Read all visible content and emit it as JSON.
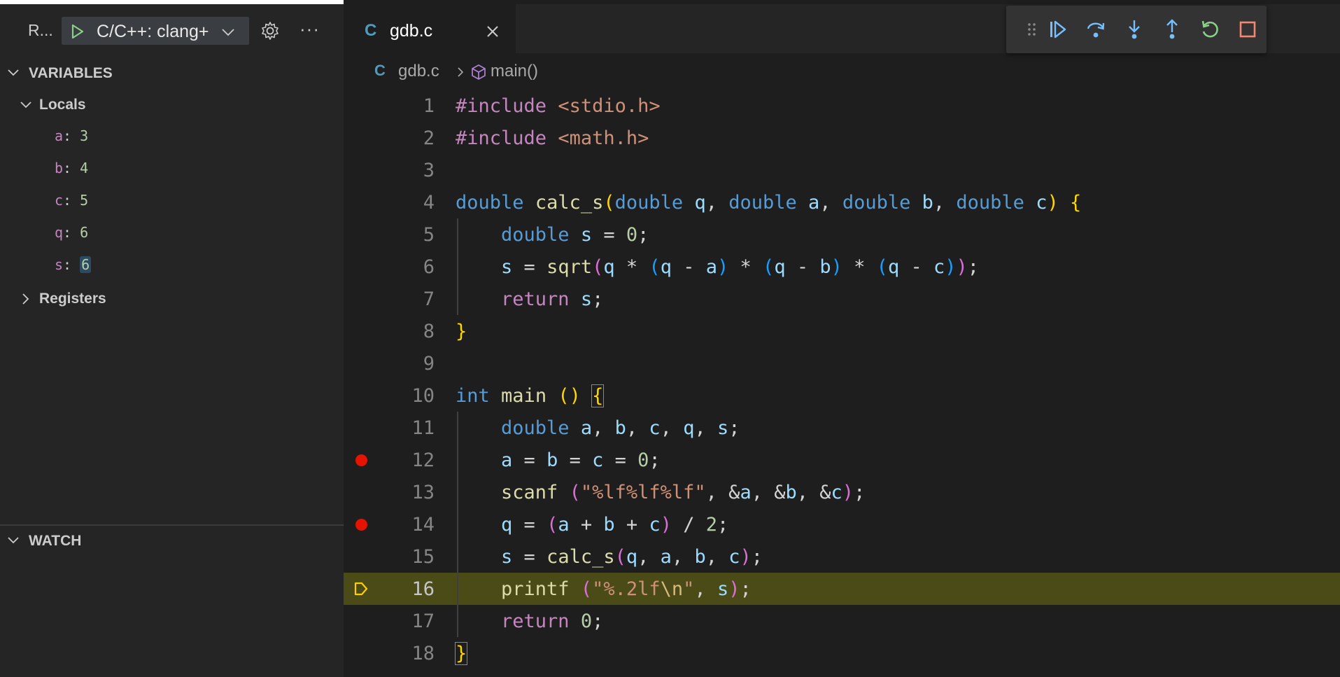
{
  "debug_toolbar": {
    "run_label": "R...",
    "config_label": "C/C++: clang+",
    "more_label": "···"
  },
  "variables": {
    "header": "VARIABLES",
    "locals_label": "Locals",
    "locals": [
      {
        "name": "a",
        "value": "3"
      },
      {
        "name": "b",
        "value": "4"
      },
      {
        "name": "c",
        "value": "5"
      },
      {
        "name": "q",
        "value": "6"
      },
      {
        "name": "s",
        "value": "6"
      }
    ],
    "registers_label": "Registers"
  },
  "watch": {
    "header": "WATCH"
  },
  "editor": {
    "tab": {
      "icon_letter": "C",
      "label": "gdb.c"
    },
    "breadcrumb": {
      "icon_letter": "C",
      "file": "gdb.c",
      "symbol": "main()"
    },
    "current_line": 16,
    "breakpoint_lines": [
      12,
      14
    ],
    "lines": [
      {
        "n": "1",
        "tokens": [
          [
            "pp",
            "#include "
          ],
          [
            "inc",
            "<stdio.h>"
          ]
        ]
      },
      {
        "n": "2",
        "tokens": [
          [
            "pp",
            "#include "
          ],
          [
            "inc",
            "<math.h>"
          ]
        ]
      },
      {
        "n": "3",
        "tokens": []
      },
      {
        "n": "4",
        "tokens": [
          [
            "kw",
            "double"
          ],
          [
            "pl",
            " "
          ],
          [
            "fn",
            "calc_s"
          ],
          [
            "b1",
            "("
          ],
          [
            "kw",
            "double"
          ],
          [
            "pl",
            " "
          ],
          [
            "var",
            "q"
          ],
          [
            "pl",
            ", "
          ],
          [
            "kw",
            "double"
          ],
          [
            "pl",
            " "
          ],
          [
            "var",
            "a"
          ],
          [
            "pl",
            ", "
          ],
          [
            "kw",
            "double"
          ],
          [
            "pl",
            " "
          ],
          [
            "var",
            "b"
          ],
          [
            "pl",
            ", "
          ],
          [
            "kw",
            "double"
          ],
          [
            "pl",
            " "
          ],
          [
            "var",
            "c"
          ],
          [
            "b1",
            ")"
          ],
          [
            "pl",
            " "
          ],
          [
            "b1",
            "{"
          ]
        ]
      },
      {
        "n": "5",
        "tokens": [
          [
            "pl",
            "    "
          ],
          [
            "kw",
            "double"
          ],
          [
            "pl",
            " "
          ],
          [
            "var",
            "s"
          ],
          [
            "pl",
            " = "
          ],
          [
            "num",
            "0"
          ],
          [
            "pl",
            ";"
          ]
        ]
      },
      {
        "n": "6",
        "tokens": [
          [
            "pl",
            "    "
          ],
          [
            "var",
            "s"
          ],
          [
            "pl",
            " = "
          ],
          [
            "fn",
            "sqrt"
          ],
          [
            "b2",
            "("
          ],
          [
            "var",
            "q"
          ],
          [
            "pl",
            " * "
          ],
          [
            "b3",
            "("
          ],
          [
            "var",
            "q"
          ],
          [
            "pl",
            " - "
          ],
          [
            "var",
            "a"
          ],
          [
            "b3",
            ")"
          ],
          [
            "pl",
            " * "
          ],
          [
            "b3",
            "("
          ],
          [
            "var",
            "q"
          ],
          [
            "pl",
            " - "
          ],
          [
            "var",
            "b"
          ],
          [
            "b3",
            ")"
          ],
          [
            "pl",
            " * "
          ],
          [
            "b3",
            "("
          ],
          [
            "var",
            "q"
          ],
          [
            "pl",
            " - "
          ],
          [
            "var",
            "c"
          ],
          [
            "b3",
            ")"
          ],
          [
            "b2",
            ")"
          ],
          [
            "pl",
            ";"
          ]
        ]
      },
      {
        "n": "7",
        "tokens": [
          [
            "pl",
            "    "
          ],
          [
            "ctrl",
            "return"
          ],
          [
            "pl",
            " "
          ],
          [
            "var",
            "s"
          ],
          [
            "pl",
            ";"
          ]
        ]
      },
      {
        "n": "8",
        "tokens": [
          [
            "b1",
            "}"
          ]
        ]
      },
      {
        "n": "9",
        "tokens": []
      },
      {
        "n": "10",
        "tokens": [
          [
            "kw",
            "int"
          ],
          [
            "pl",
            " "
          ],
          [
            "fn",
            "main"
          ],
          [
            "pl",
            " "
          ],
          [
            "b1",
            "()"
          ],
          [
            "pl",
            " "
          ],
          [
            "b1m",
            "{"
          ]
        ]
      },
      {
        "n": "11",
        "tokens": [
          [
            "pl",
            "    "
          ],
          [
            "kw",
            "double"
          ],
          [
            "pl",
            " "
          ],
          [
            "var",
            "a"
          ],
          [
            "pl",
            ", "
          ],
          [
            "var",
            "b"
          ],
          [
            "pl",
            ", "
          ],
          [
            "var",
            "c"
          ],
          [
            "pl",
            ", "
          ],
          [
            "var",
            "q"
          ],
          [
            "pl",
            ", "
          ],
          [
            "var",
            "s"
          ],
          [
            "pl",
            ";"
          ]
        ]
      },
      {
        "n": "12",
        "tokens": [
          [
            "pl",
            "    "
          ],
          [
            "var",
            "a"
          ],
          [
            "pl",
            " = "
          ],
          [
            "var",
            "b"
          ],
          [
            "pl",
            " = "
          ],
          [
            "var",
            "c"
          ],
          [
            "pl",
            " = "
          ],
          [
            "num",
            "0"
          ],
          [
            "pl",
            ";"
          ]
        ]
      },
      {
        "n": "13",
        "tokens": [
          [
            "pl",
            "    "
          ],
          [
            "fn",
            "scanf"
          ],
          [
            "pl",
            " "
          ],
          [
            "b2",
            "("
          ],
          [
            "str",
            "\"%lf%lf%lf\""
          ],
          [
            "pl",
            ", &"
          ],
          [
            "var",
            "a"
          ],
          [
            "pl",
            ", &"
          ],
          [
            "var",
            "b"
          ],
          [
            "pl",
            ", &"
          ],
          [
            "var",
            "c"
          ],
          [
            "b2",
            ")"
          ],
          [
            "pl",
            ";"
          ]
        ]
      },
      {
        "n": "14",
        "tokens": [
          [
            "pl",
            "    "
          ],
          [
            "var",
            "q"
          ],
          [
            "pl",
            " = "
          ],
          [
            "b2",
            "("
          ],
          [
            "var",
            "a"
          ],
          [
            "pl",
            " + "
          ],
          [
            "var",
            "b"
          ],
          [
            "pl",
            " + "
          ],
          [
            "var",
            "c"
          ],
          [
            "b2",
            ")"
          ],
          [
            "pl",
            " / "
          ],
          [
            "num",
            "2"
          ],
          [
            "pl",
            ";"
          ]
        ]
      },
      {
        "n": "15",
        "tokens": [
          [
            "pl",
            "    "
          ],
          [
            "var",
            "s"
          ],
          [
            "pl",
            " = "
          ],
          [
            "fn",
            "calc_s"
          ],
          [
            "b2",
            "("
          ],
          [
            "var",
            "q"
          ],
          [
            "pl",
            ", "
          ],
          [
            "var",
            "a"
          ],
          [
            "pl",
            ", "
          ],
          [
            "var",
            "b"
          ],
          [
            "pl",
            ", "
          ],
          [
            "var",
            "c"
          ],
          [
            "b2",
            ")"
          ],
          [
            "pl",
            ";"
          ]
        ]
      },
      {
        "n": "16",
        "tokens": [
          [
            "pl",
            "    "
          ],
          [
            "fn",
            "printf"
          ],
          [
            "pl",
            " "
          ],
          [
            "b2",
            "("
          ],
          [
            "str",
            "\"%.2lf"
          ],
          [
            "esc",
            "\\n"
          ],
          [
            "str",
            "\""
          ],
          [
            "pl",
            ", "
          ],
          [
            "var",
            "s"
          ],
          [
            "b2",
            ")"
          ],
          [
            "pl",
            ";"
          ]
        ]
      },
      {
        "n": "17",
        "tokens": [
          [
            "pl",
            "    "
          ],
          [
            "ctrl",
            "return"
          ],
          [
            "pl",
            " "
          ],
          [
            "num",
            "0"
          ],
          [
            "pl",
            ";"
          ]
        ]
      },
      {
        "n": "18",
        "tokens": [
          [
            "b1m",
            "}"
          ]
        ]
      }
    ]
  },
  "colors": {
    "sidebar_bg": "#252526",
    "editor_bg": "#1e1e1e",
    "current_line_bg": "#4b4b18",
    "breakpoint": "#e51400",
    "accent_blue": "#75beff",
    "continue_green": "#89d185"
  },
  "icons": {
    "floating_toolbar": [
      "drag-handle-icon",
      "continue-icon",
      "step-over-icon",
      "step-into-icon",
      "step-out-icon",
      "restart-icon",
      "stop-icon"
    ]
  }
}
